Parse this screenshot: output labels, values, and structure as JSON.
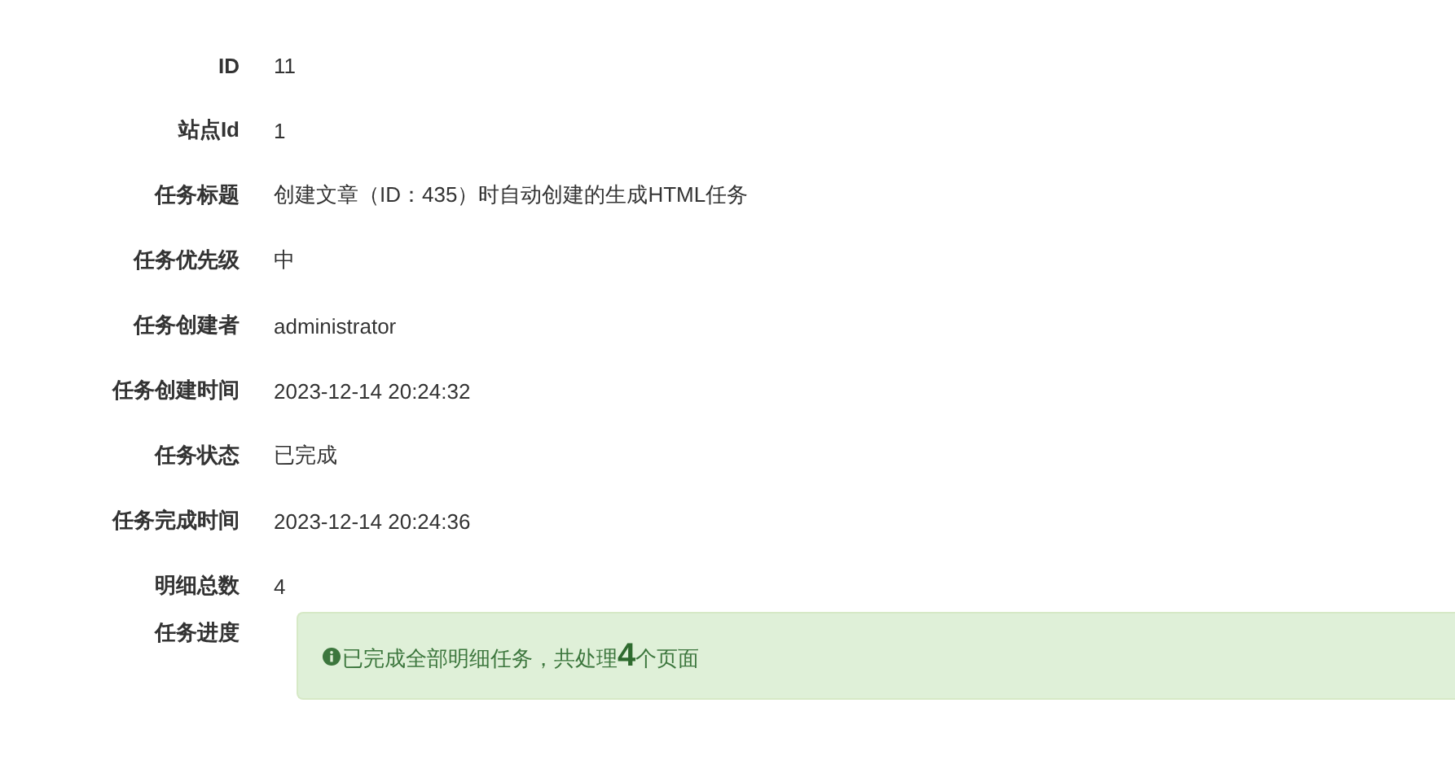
{
  "fields": [
    {
      "label": "ID",
      "value": "11"
    },
    {
      "label": "站点Id",
      "value": "1"
    },
    {
      "label": "任务标题",
      "value": "创建文章（ID：435）时自动创建的生成HTML任务"
    },
    {
      "label": "任务优先级",
      "value": "中"
    },
    {
      "label": "任务创建者",
      "value": "administrator"
    },
    {
      "label": "任务创建时间",
      "value": "2023-12-14 20:24:32"
    },
    {
      "label": "任务状态",
      "value": "已完成"
    },
    {
      "label": "任务完成时间",
      "value": "2023-12-14 20:24:36"
    },
    {
      "label": "明细总数",
      "value": "4"
    }
  ],
  "progress": {
    "label": "任务进度",
    "message": "已完成全部明细任务，共处理**4**个页面"
  }
}
